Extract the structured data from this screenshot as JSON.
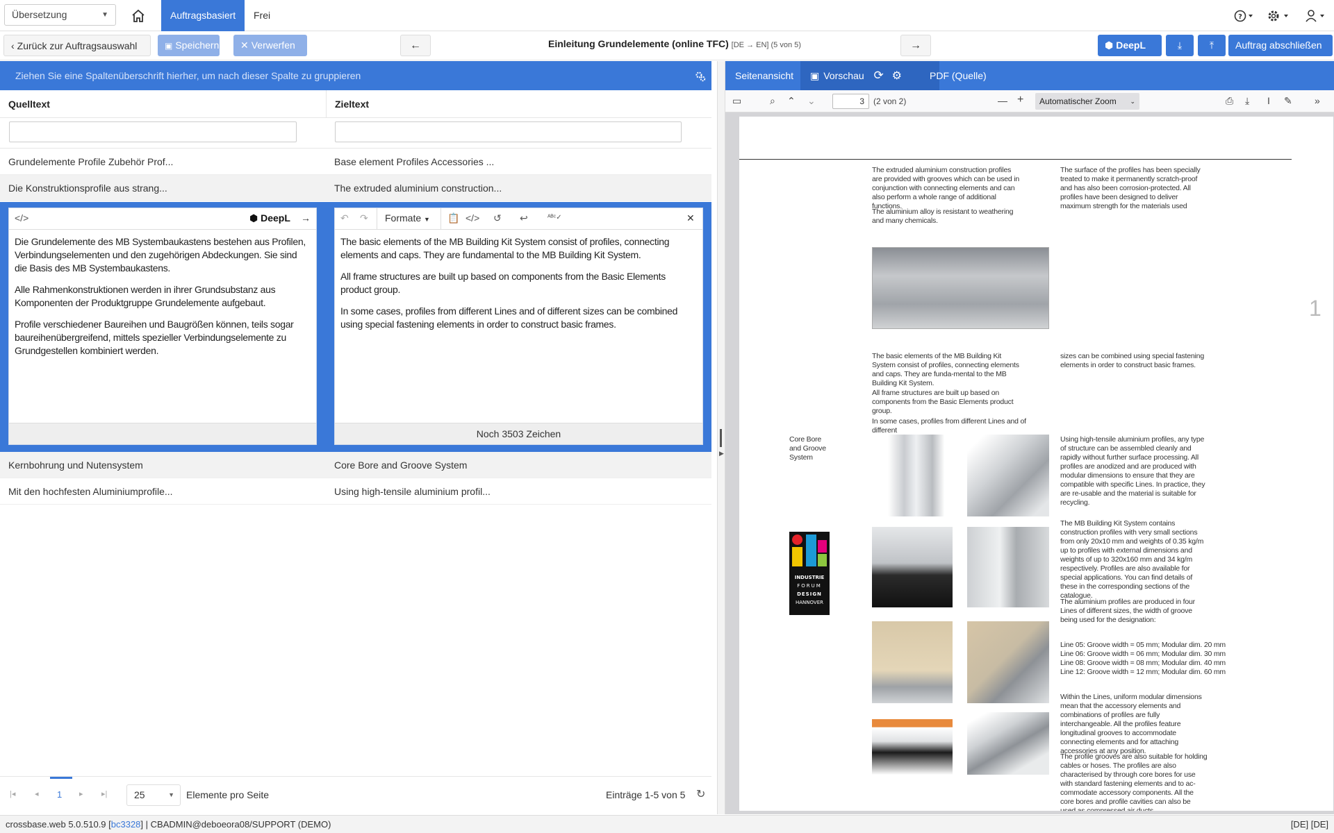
{
  "topbar": {
    "language_select": "Übersetzung",
    "tabs": [
      "Auftragsbasiert",
      "Frei"
    ]
  },
  "actionbar": {
    "back_label": "Zurück zur Auftragsauswahl",
    "save_label": "Speichern",
    "discard_label": "Verwerfen",
    "title": "Einleitung Grundelemente (online TFC)",
    "title_meta": "[DE → EN] (5 von 5)",
    "deepl_label": "DeepL",
    "finish_label": "Auftrag abschließen"
  },
  "grid": {
    "group_hint": "Ziehen Sie eine Spaltenüberschrift hierher, um nach dieser Spalte zu gruppieren",
    "columns": [
      "Quelltext",
      "Zieltext"
    ],
    "rows": [
      {
        "source": "Grundelemente Profile Zubehör Prof...",
        "target": "Base element Profiles Accessories ..."
      },
      {
        "source": "Die Konstruktionsprofile aus strang...",
        "target": "The extruded aluminium construction..."
      },
      {
        "source": "Kernbohrung und Nutensystem",
        "target": "Core Bore and Groove System"
      },
      {
        "source": "Mit den hochfesten Aluminiumprofile...",
        "target": "Using high-tensile aluminium profil..."
      }
    ]
  },
  "editor": {
    "deepl_label": "DeepL",
    "formats_label": "Formate",
    "source_paragraphs": [
      "Die Grundelemente des MB Systembaukastens bestehen aus Profilen, Verbindungselementen und den zugehörigen Abdeckungen. Sie sind die Basis des MB Systembaukastens.",
      "Alle Rahmenkonstruktionen werden in ihrer Grundsubstanz aus Komponenten der Produktgruppe Grundelemente aufgebaut.",
      "Profile verschiedener Baureihen und Baugrößen können, teils sogar baureihenübergreifend, mittels spezieller Verbindungselemente zu Grundgestellen kombiniert werden."
    ],
    "target_paragraphs": [
      "The basic elements of the MB Building Kit System consist of profiles, connecting elements and caps. They are fundamental to the MB Building Kit System.",
      "All frame structures are built up based on components from the Basic Elements product group.",
      "In some cases, profiles from different Lines and of different sizes can be combined using special fastening elements in order to construct basic frames."
    ],
    "remaining": "Noch 3503 Zeichen"
  },
  "pager": {
    "current_page": "1",
    "page_size": "25",
    "per_page_label": "Elemente pro Seite",
    "entries": "Einträge 1-5 von 5"
  },
  "preview": {
    "tabs": [
      "Seitenansicht",
      "Vorschau",
      "PDF (Quelle)"
    ],
    "page_input": "3",
    "page_of": "(2 von 2)",
    "zoom": "Automatischer Zoom",
    "page_number_mark": "1",
    "texts": {
      "t1": "The extruded aluminium construction profiles are provided with grooves which can be used in conjunction with connecting elements and can also perform a whole range of additional functions.",
      "t2": "The aluminium alloy is resistant to weathering and many chemicals.",
      "t3": "The surface of the profiles has been specially treated to make it permanently scratch-proof and has also been corrosion-protected. All profiles have been designed to deliver maximum strength for the materials used",
      "t4": "The basic elements of the MB Building Kit System consist of profiles, connecting elements and caps. They are funda-mental to the MB Building Kit System.",
      "t5": "sizes can be combined using special fastening elements in order to construct basic frames.",
      "t6": "All frame structures are built up based on components from the Basic Elements product group.",
      "t7": "In some cases, profiles from different Lines and of different",
      "t8": "Core Bore and Groove System",
      "t9": "Using high-tensile aluminium profiles, any type of structure can be assembled cleanly and rapidly without further surface processing. All profiles are anodized and are produced with modular dimensions to ensure that they are compatible with specific Lines. In practice, they are re-usable and the material is suitable for recycling.",
      "t10": "The MB Building Kit System contains construction profiles with very small sections from only 20x10 mm and weights of 0.35 kg/m up to profiles with external dimensions and weights of up to 320x160 mm and 34 kg/m respectively. Profiles are also available for special applications. You can find details of these in the corresponding sections of the catalogue.",
      "t11": "The aluminium profiles are produced in four Lines of different sizes, the width of groove being used for the designation:",
      "t12a": "Line 05: Groove width = 05 mm; Modular dim. 20 mm",
      "t12b": "Line 06: Groove width = 06 mm; Modular dim. 30 mm",
      "t12c": "Line 08: Groove width = 08 mm; Modular dim. 40 mm",
      "t12d": "Line 12: Groove width = 12 mm; Modular dim. 60 mm",
      "t13": "Within the Lines, uniform modular dimensions mean that the accessory elements and combinations of profiles are fully interchangeable. All the profiles feature longitudinal grooves to accommodate connecting elements and for attaching accessories at any position.",
      "t14": "The profile grooves are also suitable for holding cables or hoses. The profiles are also characterised by through core bores for use with standard fastening elements and to ac-commodate accessory components. All the core bores and profile cavities can also be used as compressed air ducts.",
      "logo_lines": [
        "INDUSTRIE",
        "FORUM",
        "DESIGN",
        "HANNOVER"
      ]
    }
  },
  "status": {
    "version": "crossbase.web 5.0.510.9 [",
    "build": "bc3328",
    "user": "] | CBADMIN@deboeora08/SUPPORT (DEMO)",
    "lang": "[DE] [DE]"
  },
  "colors": {
    "accent": "#3a78d8",
    "accent_light": "#8fb0e8"
  }
}
